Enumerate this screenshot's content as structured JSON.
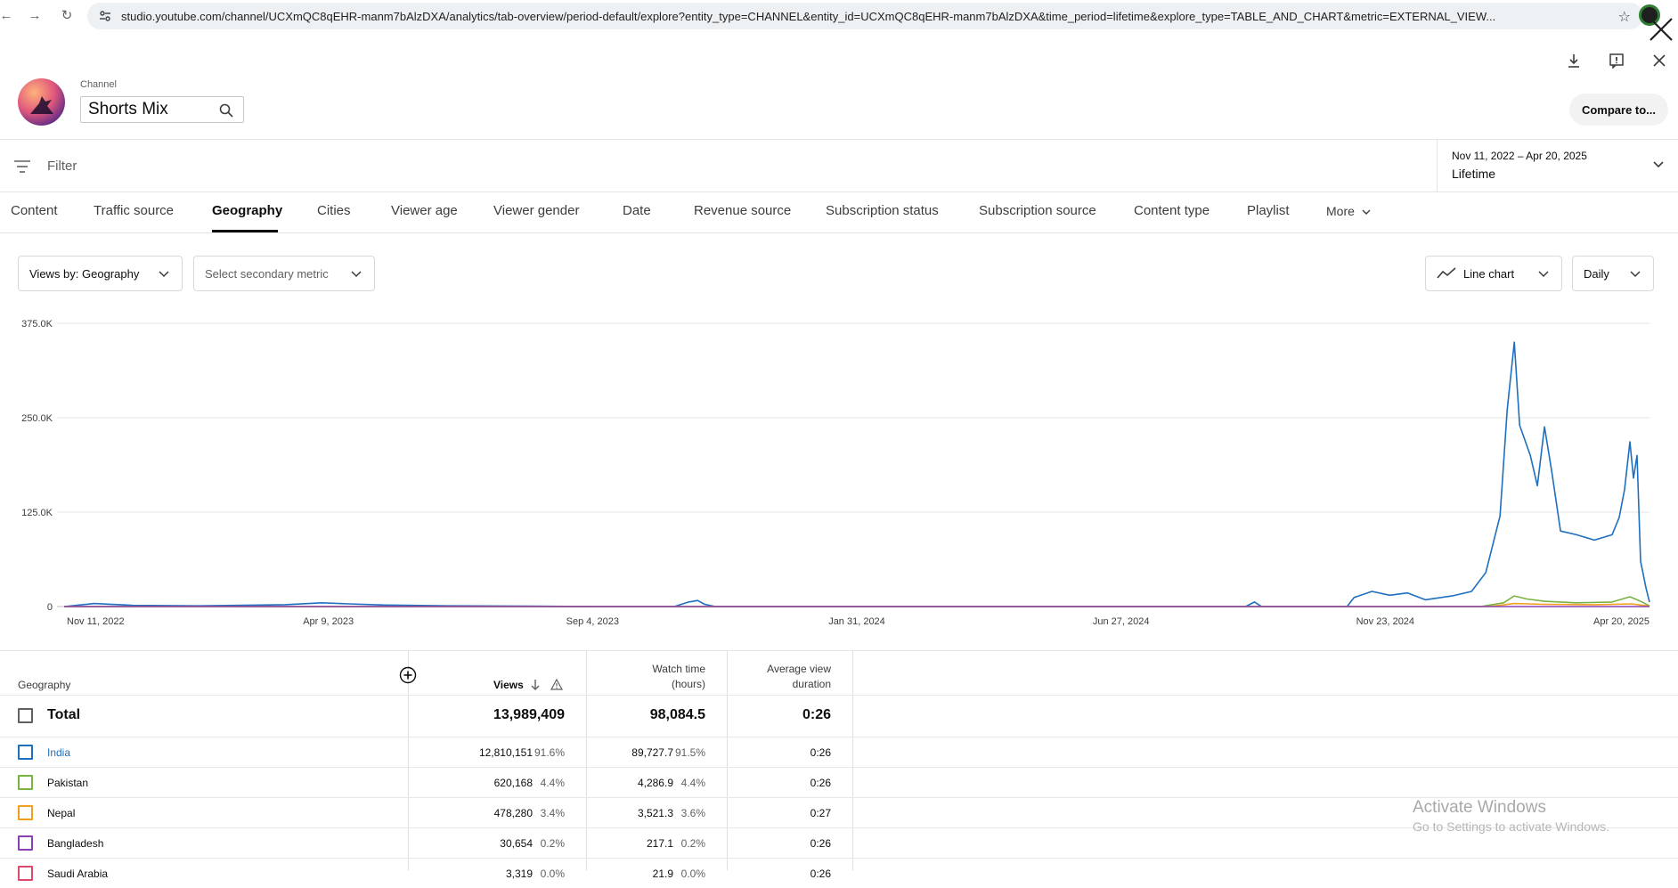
{
  "browser": {
    "url": "studio.youtube.com/channel/UCXmQC8qEHR-manm7bAlzDXA/analytics/tab-overview/period-default/explore?entity_type=CHANNEL&entity_id=UCXmQC8qEHR-manm7bAlzDXA&time_period=lifetime&explore_type=TABLE_AND_CHART&metric=EXTERNAL_VIEW..."
  },
  "header": {
    "channel_label": "Channel",
    "channel_name": "Shorts Mix",
    "compare_label": "Compare to..."
  },
  "filter": {
    "label": "Filter",
    "date_range": "Nov 11, 2022 – Apr 20, 2025",
    "period": "Lifetime"
  },
  "tabs": [
    {
      "label": "Content"
    },
    {
      "label": "Traffic source"
    },
    {
      "label": "Geography"
    },
    {
      "label": "Cities"
    },
    {
      "label": "Viewer age"
    },
    {
      "label": "Viewer gender"
    },
    {
      "label": "Date"
    },
    {
      "label": "Revenue source"
    },
    {
      "label": "Subscription status"
    },
    {
      "label": "Subscription source"
    },
    {
      "label": "Content type"
    },
    {
      "label": "Playlist"
    },
    {
      "label": "More"
    }
  ],
  "active_tab": "Geography",
  "controls": {
    "primary_metric": "Views by: Geography",
    "secondary_metric": "Select secondary metric",
    "chart_type": "Line chart",
    "interval": "Daily"
  },
  "chart_data": {
    "type": "line",
    "x_labels": [
      "Nov 11, 2022",
      "Apr 9, 2023",
      "Sep 4, 2023",
      "Jan 31, 2024",
      "Jun 27, 2024",
      "Nov 23, 2024",
      "Apr 20, 2025"
    ],
    "y_ticks": [
      "375.0K",
      "250.0K",
      "125.0K",
      "0"
    ],
    "ylim": [
      0,
      375000
    ],
    "x_range": [
      "2022-11-11",
      "2025-04-20"
    ],
    "grid": true,
    "series": [
      {
        "name": "India",
        "color": "#1f6fbf",
        "points": [
          [
            "2022-11-11",
            0
          ],
          [
            "2022-11-28",
            4000
          ],
          [
            "2022-12-20",
            1500
          ],
          [
            "2023-01-25",
            1000
          ],
          [
            "2023-03-15",
            2500
          ],
          [
            "2023-04-05",
            5000
          ],
          [
            "2023-04-20",
            3500
          ],
          [
            "2023-05-10",
            2000
          ],
          [
            "2023-06-15",
            1000
          ],
          [
            "2023-08-01",
            500
          ],
          [
            "2023-09-15",
            0
          ],
          [
            "2023-10-20",
            0
          ],
          [
            "2023-10-28",
            6000
          ],
          [
            "2023-11-02",
            8000
          ],
          [
            "2023-11-06",
            3000
          ],
          [
            "2023-11-12",
            0
          ],
          [
            "2024-06-10",
            0
          ],
          [
            "2024-09-05",
            0
          ],
          [
            "2024-09-10",
            6000
          ],
          [
            "2024-09-14",
            0
          ],
          [
            "2024-11-01",
            0
          ],
          [
            "2024-11-05",
            12000
          ],
          [
            "2024-11-15",
            20000
          ],
          [
            "2024-11-25",
            15000
          ],
          [
            "2024-12-05",
            18000
          ],
          [
            "2024-12-15",
            9000
          ],
          [
            "2024-12-30",
            14000
          ],
          [
            "2025-01-10",
            20000
          ],
          [
            "2025-01-18",
            45000
          ],
          [
            "2025-01-26",
            120000
          ],
          [
            "2025-01-30",
            260000
          ],
          [
            "2025-02-03",
            350000
          ],
          [
            "2025-02-06",
            240000
          ],
          [
            "2025-02-09",
            220000
          ],
          [
            "2025-02-12",
            200000
          ],
          [
            "2025-02-16",
            160000
          ],
          [
            "2025-02-20",
            238000
          ],
          [
            "2025-02-24",
            180000
          ],
          [
            "2025-03-01",
            100000
          ],
          [
            "2025-03-10",
            95000
          ],
          [
            "2025-03-20",
            88000
          ],
          [
            "2025-03-30",
            95000
          ],
          [
            "2025-04-03",
            118000
          ],
          [
            "2025-04-06",
            155000
          ],
          [
            "2025-04-09",
            218000
          ],
          [
            "2025-04-11",
            170000
          ],
          [
            "2025-04-13",
            200000
          ],
          [
            "2025-04-15",
            60000
          ],
          [
            "2025-04-18",
            25000
          ],
          [
            "2025-04-20",
            6000
          ]
        ]
      },
      {
        "name": "Pakistan",
        "color": "#79b342",
        "points": [
          [
            "2022-11-11",
            0
          ],
          [
            "2025-01-15",
            0
          ],
          [
            "2025-01-28",
            5000
          ],
          [
            "2025-02-03",
            14000
          ],
          [
            "2025-02-10",
            10000
          ],
          [
            "2025-02-20",
            7000
          ],
          [
            "2025-03-10",
            5000
          ],
          [
            "2025-03-30",
            6000
          ],
          [
            "2025-04-09",
            13000
          ],
          [
            "2025-04-14",
            8000
          ],
          [
            "2025-04-20",
            1000
          ]
        ]
      },
      {
        "name": "Nepal",
        "color": "#f29e1f",
        "points": [
          [
            "2022-11-11",
            0
          ],
          [
            "2025-01-20",
            0
          ],
          [
            "2025-02-03",
            4000
          ],
          [
            "2025-02-20",
            3000
          ],
          [
            "2025-03-20",
            2500
          ],
          [
            "2025-04-10",
            3500
          ],
          [
            "2025-04-20",
            500
          ]
        ]
      },
      {
        "name": "Bangladesh",
        "color": "#8a3fb5",
        "points": [
          [
            "2022-11-11",
            0
          ],
          [
            "2025-04-20",
            0
          ]
        ]
      }
    ]
  },
  "table": {
    "columns": {
      "geography": "Geography",
      "views": "Views",
      "watch_time": [
        "Watch time",
        "(hours)"
      ],
      "avg_duration": [
        "Average view",
        "duration"
      ]
    },
    "total": {
      "label": "Total",
      "views": "13,989,409",
      "watch": "98,084.5",
      "avg": "0:26"
    },
    "rows": [
      {
        "name": "India",
        "views": "12,810,151",
        "views_pct": "91.6%",
        "watch": "89,727.7",
        "watch_pct": "91.5%",
        "avg": "0:26",
        "color": "#1f6fbf"
      },
      {
        "name": "Pakistan",
        "views": "620,168",
        "views_pct": "4.4%",
        "watch": "4,286.9",
        "watch_pct": "4.4%",
        "avg": "0:26",
        "color": "#79b342"
      },
      {
        "name": "Nepal",
        "views": "478,280",
        "views_pct": "3.4%",
        "watch": "3,521.3",
        "watch_pct": "3.6%",
        "avg": "0:27",
        "color": "#f29e1f"
      },
      {
        "name": "Bangladesh",
        "views": "30,654",
        "views_pct": "0.2%",
        "watch": "217.1",
        "watch_pct": "0.2%",
        "avg": "0:26",
        "color": "#8a3fb5"
      },
      {
        "name": "Saudi Arabia",
        "views": "3,319",
        "views_pct": "0.0%",
        "watch": "21.9",
        "watch_pct": "0.0%",
        "avg": "0:26",
        "color": "#d94c6b"
      }
    ]
  },
  "watermark": {
    "title": "Activate Windows",
    "subtitle": "Go to Settings to activate Windows."
  }
}
